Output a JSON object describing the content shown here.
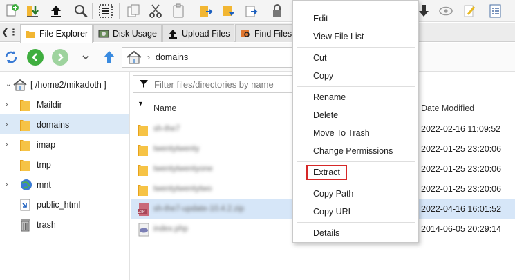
{
  "tabs": [
    {
      "label": "File Explorer",
      "icon": "folder-tab-icon",
      "active": true
    },
    {
      "label": "Disk Usage",
      "icon": "disk-usage-icon",
      "active": false
    },
    {
      "label": "Upload Files",
      "icon": "upload-icon",
      "active": false
    },
    {
      "label": "Find Files",
      "icon": "find-files-icon",
      "active": false
    }
  ],
  "path": {
    "segment": "domains"
  },
  "tree": {
    "root": "[ /home2/mikadoth ]",
    "items": [
      {
        "label": "Maildir",
        "icon": "folder-icon"
      },
      {
        "label": "domains",
        "icon": "folder-icon"
      },
      {
        "label": "imap",
        "icon": "folder-icon"
      },
      {
        "label": "tmp",
        "icon": "folder-icon"
      },
      {
        "label": "mnt",
        "icon": "globe-icon"
      },
      {
        "label": "public_html",
        "icon": "web-folder-icon"
      },
      {
        "label": "trash",
        "icon": "trash-icon"
      }
    ]
  },
  "filter": {
    "placeholder": "Filter files/directories by name"
  },
  "columns": {
    "name": "Name",
    "date": "Date Modified"
  },
  "files": [
    {
      "name": "sh-the7",
      "date": "2022-02-16 11:09:52",
      "icon": "folder-icon"
    },
    {
      "name": "twentytwenty",
      "date": "2022-01-25 23:20:06",
      "icon": "folder-icon"
    },
    {
      "name": "twentytwentyone",
      "date": "2022-01-25 23:20:06",
      "icon": "folder-icon"
    },
    {
      "name": "twentytwentytwo",
      "date": "2022-01-25 23:20:06",
      "icon": "folder-icon"
    },
    {
      "name": "sh-the7-update-10.4.2.zip",
      "date": "2022-04-16 16:01:52",
      "icon": "zip-file-icon"
    },
    {
      "name": "index.php",
      "date": "2014-06-05 20:29:14",
      "icon": "php-file-icon"
    }
  ],
  "context_menu": {
    "groups": [
      [
        "Edit",
        "View File List"
      ],
      [
        "Cut",
        "Copy"
      ],
      [
        "Rename",
        "Delete",
        "Move To Trash",
        "Change Permissions"
      ],
      [
        "Extract"
      ],
      [
        "Copy Path",
        "Copy URL"
      ],
      [
        "Details"
      ]
    ],
    "highlighted": "Extract"
  },
  "colors": {
    "selection": "#d6e6f8",
    "highlight_box": "#d62828",
    "folder": "#f2b632",
    "nav_green": "#3fae3f"
  }
}
